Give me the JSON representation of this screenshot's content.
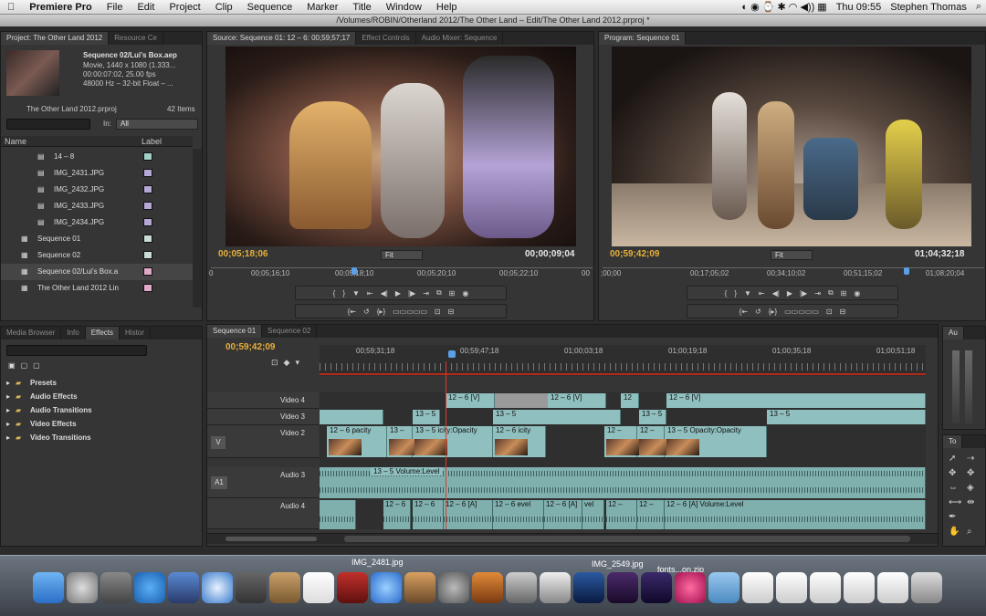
{
  "menubar": {
    "apple": "",
    "app_name": "Premiere Pro",
    "items": [
      "File",
      "Edit",
      "Project",
      "Clip",
      "Sequence",
      "Marker",
      "Title",
      "Window",
      "Help"
    ],
    "clock": "Thu 09:55",
    "user": "Stephen Thomas"
  },
  "window_title": "/Volumes/ROBIN/Otherland 2012/The Other Land – Edit/The Other Land 2012.prproj *",
  "project": {
    "tabs": [
      "Project: The Other Land 2012",
      "Resource Ce"
    ],
    "preview_name": "Sequence 02/Lui's Box.aep",
    "preview_line2": "Movie, 1440 x 1080 (1.333...",
    "preview_line3": "00:00:07:02, 25.00 fps",
    "preview_line4": "48000 Hz – 32-bit Float – ...",
    "file_name": "The Other Land 2012.prproj",
    "item_count": "42 Items",
    "in_label": "In:",
    "in_value": "All",
    "col_name": "Name",
    "col_label": "Label",
    "items": [
      {
        "name": "14 – 8",
        "color": "#9fd3c7"
      },
      {
        "name": "IMG_2431.JPG",
        "color": "#b6a8d6"
      },
      {
        "name": "IMG_2432.JPG",
        "color": "#b6a8d6"
      },
      {
        "name": "IMG_2433.JPG",
        "color": "#b6a8d6"
      },
      {
        "name": "IMG_2434.JPG",
        "color": "#b6a8d6"
      },
      {
        "name": "Sequence 01",
        "color": "#c9dcd6"
      },
      {
        "name": "Sequence 02",
        "color": "#c9dcd6"
      },
      {
        "name": "Sequence 02/Lui's Box.a",
        "color": "#e0a9c4"
      },
      {
        "name": "The Other Land 2012 Lin",
        "color": "#e0a9c4"
      }
    ]
  },
  "source": {
    "tabs": [
      "Source: Sequence 01: 12 – 6: 00;59;57;17",
      "Effect Controls",
      "Audio Mixer: Sequence"
    ],
    "tc_in": "00;05;18;06",
    "fit": "Fit",
    "tc_dur": "00;00;09;04",
    "ruler": [
      "0",
      "00;05;16;10",
      "00;05;18;10",
      "00;05;20;10",
      "00;05;22;10",
      "00"
    ]
  },
  "program": {
    "tabs": [
      "Program: Sequence 01"
    ],
    "tc_in": "00;59;42;09",
    "fit": "Fit",
    "tc_dur": "01;04;32;18",
    "ruler": [
      ";00;00",
      "00;17;05;02",
      "00;34;10;02",
      "00;51;15;02",
      "01;08;20;04"
    ]
  },
  "effects": {
    "tabs": [
      "Media Browser",
      "Info",
      "Effects",
      "Histor"
    ],
    "folders": [
      "Presets",
      "Audio Effects",
      "Audio Transitions",
      "Video Effects",
      "Video Transitions"
    ]
  },
  "timeline": {
    "tabs": [
      "Sequence 01",
      "Sequence 02"
    ],
    "timecode": "00;59;42;09",
    "ruler": [
      "00;59;31;18",
      "00;59;47;18",
      "01;00;03;18",
      "01;00;19;18",
      "01;00;35;18",
      "01;00;51;18"
    ],
    "tracks": {
      "video4": "Video 4",
      "video3": "Video 3",
      "video2": "Video 2",
      "audio3": "Audio 3",
      "audio4": "Audio 4",
      "v": "V",
      "a1": "A1"
    },
    "clips": {
      "v4a": "12 – 6 [V]",
      "v4b": "12 – 6 [V]",
      "v4c": "12",
      "v4d": "12 – 6 [V]",
      "v3a": "13 – 5",
      "v3b": "13 – 5",
      "v3c": "13 – 5",
      "v3d": "13 – 5",
      "v2a": "12 – 6 pacity",
      "v2b": "13 –",
      "v2c": "13 – 5 icity:Opacity",
      "v2d": "12 – 6 icity",
      "v2e": "12 –",
      "v2f": "12 –",
      "v2g": "13 – 5 Opacity:Opacity",
      "a3a": "13 – 5 Volume:Level",
      "a4a": "12 – 6",
      "a4b": "12 – 6",
      "a4c": "12 – 6 [A]",
      "a4d": "12 – 6 evel",
      "a4e": "12 – 6 [A]",
      "a4f": "vel",
      "a4g": "12 –",
      "a4h": "12 –",
      "a4i": "12 – 6 [A] Volume:Level"
    }
  },
  "right_panels": {
    "audio_tab": "Au",
    "tools_tab": "To"
  },
  "dock": {
    "labels": [
      "IMG_2481.jpg",
      "IMG_2549.jpg",
      "fonts...on.zip"
    ]
  },
  "colors": {
    "timecode": "#e6b03a",
    "clip": "#8fbfbe",
    "playhead": "#e03a2a"
  }
}
